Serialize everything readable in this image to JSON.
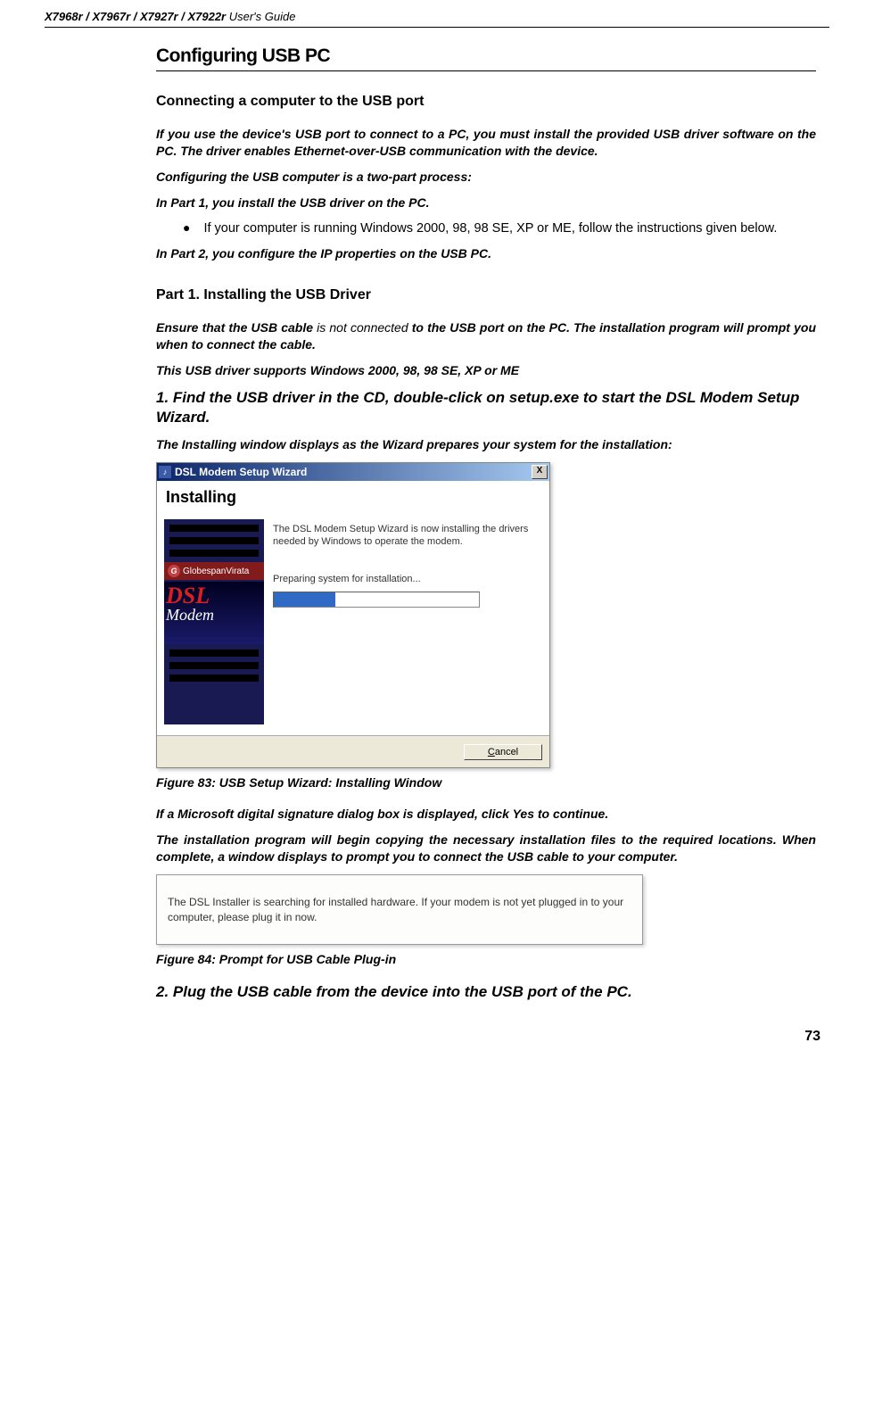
{
  "header": {
    "models": "X7968r / X7967r / X7927r / X7922r",
    "guide": " User's Guide"
  },
  "section_title": "Configuring USB PC",
  "h_connecting": "Connecting a computer to the USB port",
  "p_intro": "If you use the device's USB port to connect to a PC, you must install the provided USB driver software on the PC. The driver enables Ethernet-over-USB communication with the device.",
  "p_twopart": "Configuring the USB computer is a two-part process:",
  "p_part1": "In Part 1, you install the USB driver on the PC.",
  "bullet1": "If your computer is running Windows 2000, 98, 98 SE, XP or ME, follow the instructions given below.",
  "p_part2": "In Part 2, you configure the IP properties on the USB PC.",
  "h_part1": "Part 1. Installing the USB Driver",
  "p_ensure_a": "Ensure that the USB cable ",
  "p_ensure_b": "is not connected",
  "p_ensure_c": " to the USB port on the PC. The installation program will prompt you when to connect the cable.",
  "p_supports": "This USB driver supports Windows 2000, 98, 98 SE, XP or ME",
  "step1": "1. Find the USB driver in the CD, double-click on setup.exe to start the DSL Modem Setup Wizard.",
  "p_installwin": "The Installing window displays as the Wizard prepares your system for the installation:",
  "wizard": {
    "title": "DSL Modem Setup Wizard",
    "close": "X",
    "heading": "Installing",
    "brand": "GlobespanVirata",
    "brand_g": "G",
    "dsl": "DSL",
    "modem": "Modem",
    "msg1": "The DSL Modem Setup Wizard is now installing the drivers needed by Windows to operate the modem.",
    "msg2": "Preparing system for installation...",
    "cancel_u": "C",
    "cancel_rest": "ancel"
  },
  "caption83": "Figure 83: USB Setup Wizard: Installing Window",
  "p_digsig": "If a Microsoft digital signature dialog box is displayed, click Yes to continue.",
  "p_copying": "The installation program will begin copying the necessary installation files to the required locations. When complete, a window displays to prompt you to connect the USB cable to your computer.",
  "prompt_text": "The DSL Installer is searching for installed hardware.  If your modem is not yet plugged in to your computer, please plug it in now.",
  "caption84": "Figure 84: Prompt for USB Cable Plug-in",
  "step2": "2. Plug the USB cable from the device into the USB port of the PC.",
  "page_num": "73"
}
